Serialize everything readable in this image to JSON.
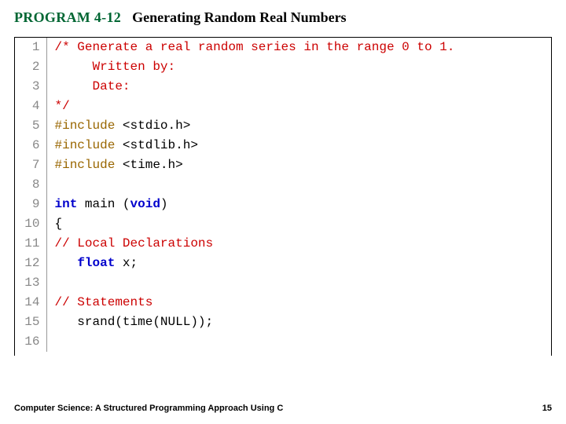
{
  "header": {
    "program_label": "PROGRAM 4-12",
    "program_title": "Generating Random Real Numbers"
  },
  "code": {
    "lines": [
      {
        "n": "1",
        "tokens": [
          {
            "t": "/* Generate a real random series in the range 0 to 1.",
            "c": "c-comment"
          }
        ]
      },
      {
        "n": "2",
        "tokens": [
          {
            "t": "     Written by:",
            "c": "c-comment"
          }
        ]
      },
      {
        "n": "3",
        "tokens": [
          {
            "t": "     Date:",
            "c": "c-comment"
          }
        ]
      },
      {
        "n": "4",
        "tokens": [
          {
            "t": "*/",
            "c": "c-comment"
          }
        ]
      },
      {
        "n": "5",
        "tokens": [
          {
            "t": "#include ",
            "c": "c-pre"
          },
          {
            "t": "<stdio.h>",
            "c": "c-text"
          }
        ]
      },
      {
        "n": "6",
        "tokens": [
          {
            "t": "#include ",
            "c": "c-pre"
          },
          {
            "t": "<stdlib.h>",
            "c": "c-text"
          }
        ]
      },
      {
        "n": "7",
        "tokens": [
          {
            "t": "#include ",
            "c": "c-pre"
          },
          {
            "t": "<time.h>",
            "c": "c-text"
          }
        ]
      },
      {
        "n": "8",
        "tokens": [
          {
            "t": "",
            "c": "c-text"
          }
        ]
      },
      {
        "n": "9",
        "tokens": [
          {
            "t": "int ",
            "c": "c-keyword"
          },
          {
            "t": "main (",
            "c": "c-text"
          },
          {
            "t": "void",
            "c": "c-keyword"
          },
          {
            "t": ")",
            "c": "c-text"
          }
        ]
      },
      {
        "n": "10",
        "tokens": [
          {
            "t": "{",
            "c": "c-text"
          }
        ]
      },
      {
        "n": "11",
        "tokens": [
          {
            "t": "// Local Declarations",
            "c": "c-comment"
          }
        ]
      },
      {
        "n": "12",
        "tokens": [
          {
            "t": "   ",
            "c": "c-text"
          },
          {
            "t": "float ",
            "c": "c-keyword"
          },
          {
            "t": "x;",
            "c": "c-text"
          }
        ]
      },
      {
        "n": "13",
        "tokens": [
          {
            "t": "",
            "c": "c-text"
          }
        ]
      },
      {
        "n": "14",
        "tokens": [
          {
            "t": "// Statements",
            "c": "c-comment"
          }
        ]
      },
      {
        "n": "15",
        "tokens": [
          {
            "t": "   srand(time(NULL));",
            "c": "c-text"
          }
        ]
      },
      {
        "n": "16",
        "tokens": [
          {
            "t": "",
            "c": "c-text"
          }
        ]
      }
    ]
  },
  "footer": {
    "text": "Computer Science: A Structured Programming Approach Using C",
    "page": "15"
  }
}
